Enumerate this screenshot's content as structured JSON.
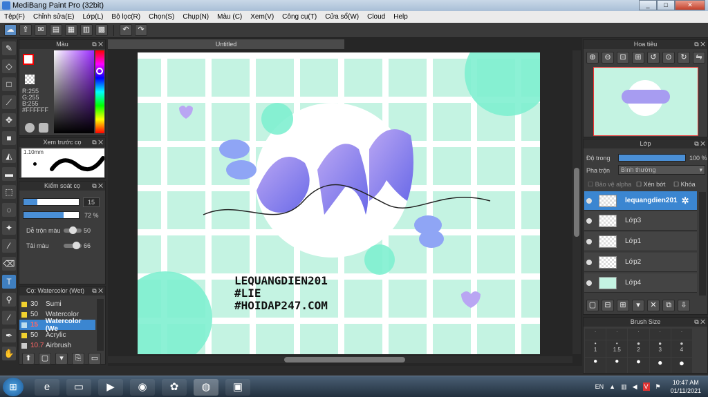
{
  "window": {
    "title": "MediBang Paint Pro (32bit)",
    "min": "_",
    "max": "□",
    "close": "✕"
  },
  "menu": [
    "Tệp(F)",
    "Chỉnh sửa(E)",
    "Lớp(L)",
    "Bộ lọc(R)",
    "Chọn(S)",
    "Chụp(N)",
    "Màu (C)",
    "Xem(V)",
    "Công cụ(T)",
    "Cửa sổ(W)",
    "Cloud",
    "Help"
  ],
  "color_panel": {
    "title": "Màu",
    "rgb": [
      "R:255",
      "G:255",
      "B:255"
    ],
    "hex": "#FFFFFF"
  },
  "brush_preview": {
    "title": "Xem trước cọ",
    "size": "1.10mm"
  },
  "brush_control": {
    "title": "Kiểm soát cọ",
    "size": "15",
    "opacity": "72 %",
    "opacity_fraction": 0.72,
    "size_fraction": 0.25,
    "mix_label": "Dễ trộn màu",
    "mix_value": "50",
    "amount_label": "Tải màu",
    "amount_value": "66"
  },
  "brush_list": {
    "title": "Cọ: Watercolor (Wet)",
    "items": [
      {
        "num": "30",
        "name": "Sumi"
      },
      {
        "num": "50",
        "name": "Watercolor"
      },
      {
        "num": "15",
        "name": "Watercolor (We",
        "selected": true
      },
      {
        "num": "50",
        "name": "Acrylic"
      },
      {
        "num": "10.7",
        "name": "Airbrush"
      }
    ]
  },
  "document": {
    "tab": "Untitled"
  },
  "artwork": {
    "text_lines": [
      "LEQUANGDIEN201",
      "#LIE",
      "#HOIDAP247.COM"
    ]
  },
  "navigator": {
    "title": "Hoa tiêu"
  },
  "layer_panel": {
    "title": "Lớp",
    "opacity_label": "Độ trong",
    "opacity_value": "100 %",
    "blend_label": "Pha trộn",
    "blend_value": "Bình thường",
    "protect_alpha": "Bảo vệ alpha",
    "clip": "Xén bớt",
    "lock": "Khóa"
  },
  "layers": [
    {
      "name": "lequangdien201",
      "selected": true
    },
    {
      "name": "Lớp3"
    },
    {
      "name": "Lớp1"
    },
    {
      "name": "Lớp2"
    },
    {
      "name": "Lớp4"
    }
  ],
  "brush_size": {
    "title": "Brush Size",
    "labels": [
      "1",
      "1.5",
      "2",
      "3",
      "4"
    ]
  },
  "tray": {
    "lang": "EN",
    "time": "10:47 AM",
    "date": "01/11/2021"
  }
}
